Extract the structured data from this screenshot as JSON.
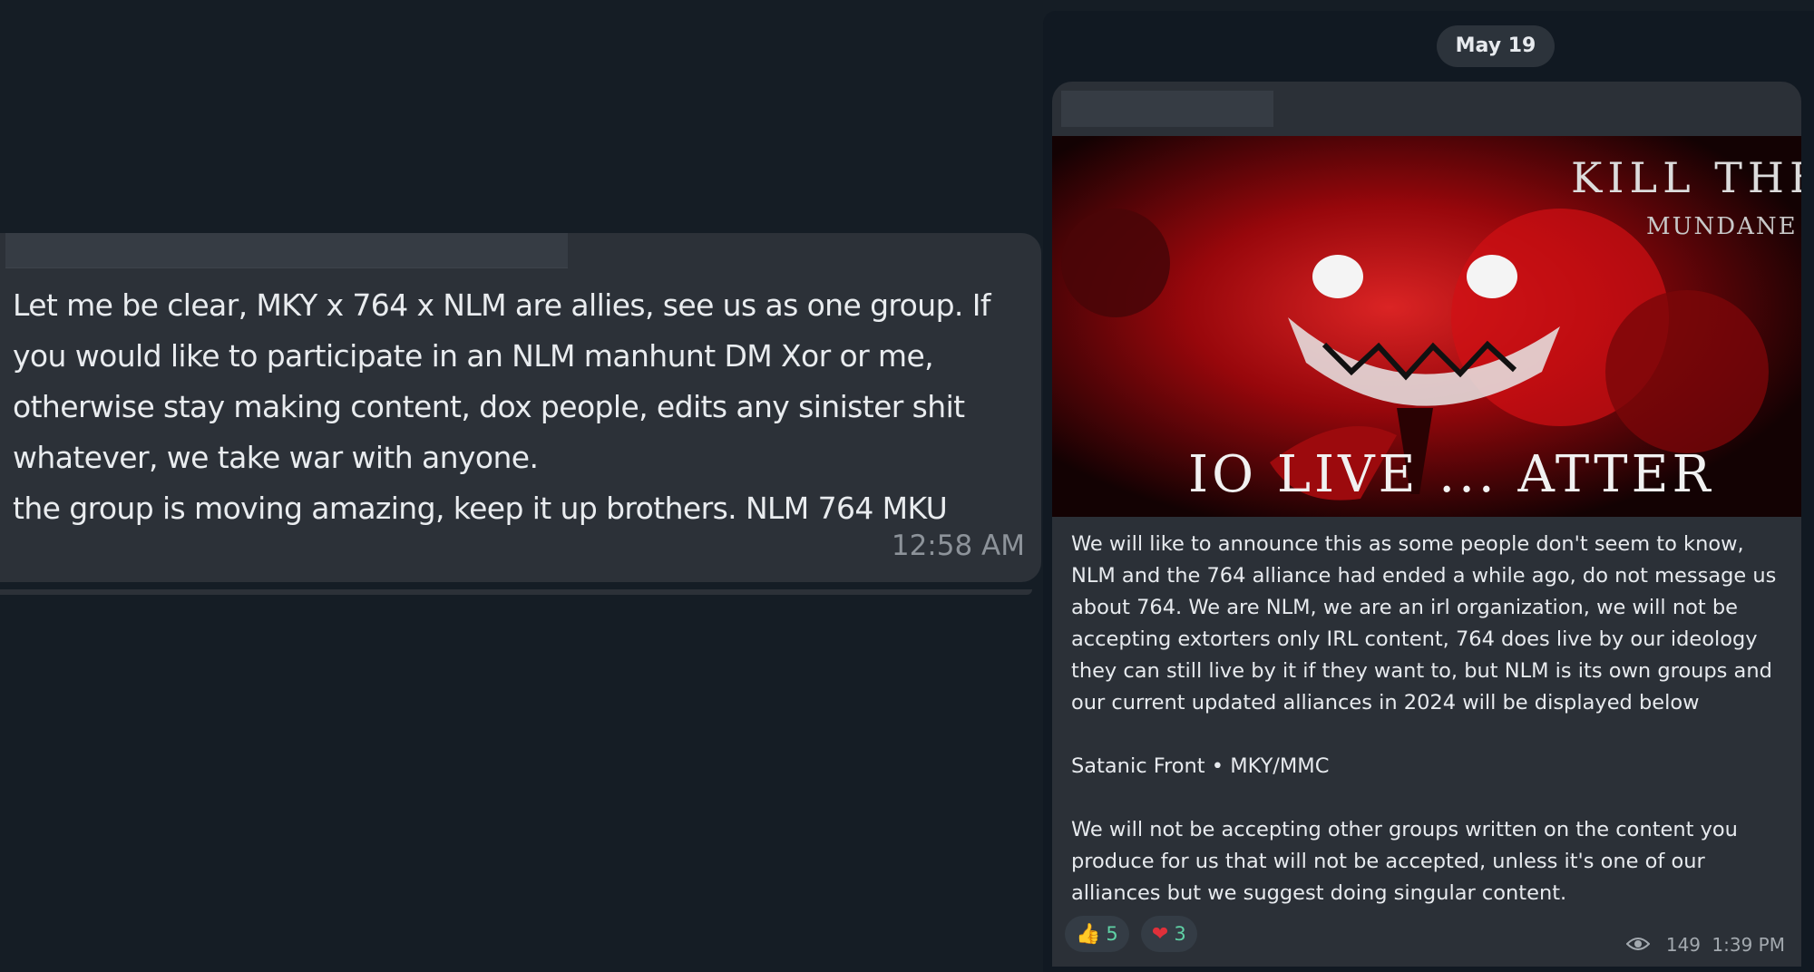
{
  "left_message": {
    "text": "Let me be clear, MKY x 764 x NLM are allies, see us as one group. If\nyou would like to participate in an NLM manhunt DM Xor or me,\notherwise stay making content, dox people, edits any sinister shit\nwhatever, we take war with anyone.\nthe group is moving amazing, keep it up brothers. NLM 764 MKU",
    "time": "12:58 AM"
  },
  "right_post": {
    "date": "May 19",
    "image_text_top": "KILL THE",
    "image_text_top2": "MUNDANE",
    "image_text_bottom": "IO LIVE ... ATTER",
    "text": "We will like to announce this as some people don't seem to know,\nNLM and the 764 alliance had ended a while ago, do not message us\nabout 764. We are NLM, we are an irl organization, we will not be\naccepting extorters only IRL content, 764 does live by our ideology\nthey can still live by it if they want to, but NLM is its own groups and\nour current updated alliances in 2024 will be displayed below\n\nSatanic Front • MKY/MMC\n\nWe will not be accepting other groups written on the content you\nproduce for us that will not be accepted, unless it's one of our\nalliances but we suggest doing singular content.",
    "reactions": [
      {
        "icon": "thumbs-up-icon",
        "glyph": "👍",
        "count": "5"
      },
      {
        "icon": "heart-icon",
        "glyph": "❤",
        "count": "3"
      }
    ],
    "views": "149",
    "time": "1:39 PM"
  },
  "colors": {
    "background": "#151d25",
    "bubble": "#2c3138",
    "reaction_count": "#5fd1a5",
    "image_red": "#c3141a"
  }
}
